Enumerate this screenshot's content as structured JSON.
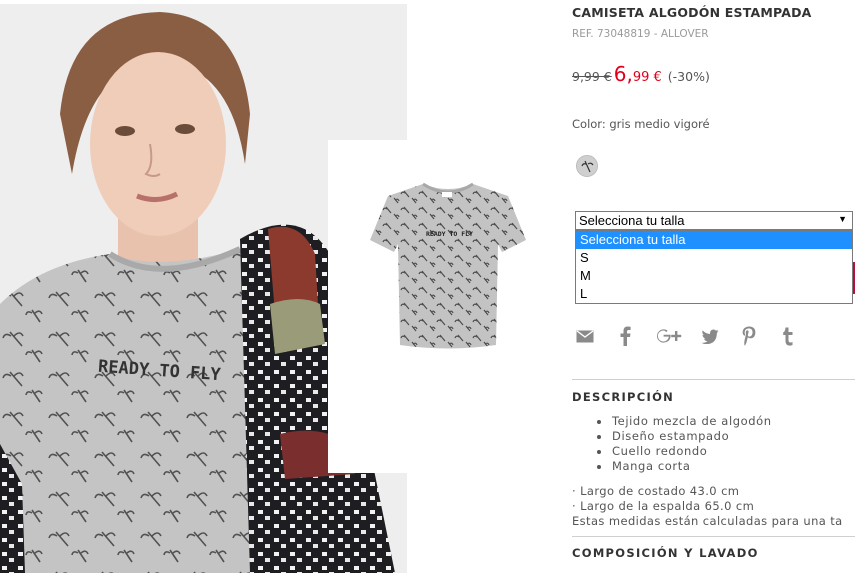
{
  "product": {
    "title": "CAMISETA ALGODÓN ESTAMPADA",
    "ref": "REF. 73048819 - ALLOVER",
    "old_price": "9,99 €",
    "new_price_int": "6,",
    "new_price_dec": "99 €",
    "discount": "(-30%)",
    "color_label": "Color: gris medio vigoré"
  },
  "size_select": {
    "selected": "Selecciona tu talla",
    "options": [
      "Selecciona tu talla",
      "S",
      "M",
      "L"
    ]
  },
  "share": {
    "items": [
      {
        "name": "email-icon",
        "glyph": "✉"
      },
      {
        "name": "facebook-icon",
        "glyph": "f"
      },
      {
        "name": "google-plus-icon",
        "glyph": "G+"
      },
      {
        "name": "twitter-icon",
        "glyph": "bird"
      },
      {
        "name": "pinterest-icon",
        "glyph": "P"
      },
      {
        "name": "tumblr-icon",
        "glyph": "t"
      }
    ]
  },
  "description": {
    "title": "DESCRIPCIÓN",
    "bullets": [
      "Tejido mezcla de algodón",
      "Diseño estampado",
      "Cuello redondo",
      "Manga corta"
    ],
    "measures": [
      "· Largo de costado 43.0 cm",
      "· Largo de la espalda 65.0 cm",
      "Estas medidas están calculadas para una ta"
    ]
  },
  "composition": {
    "title": "COMPOSICIÓN Y LAVADO"
  },
  "images": {
    "model_print_text": "READY TO FLY",
    "flat_print_text": "READY TO FLY"
  },
  "colors": {
    "sale_red": "#e0001b",
    "select_highlight": "#1e90ff",
    "buy_button": "#b30f3a",
    "icon_gray": "#8a8a8a"
  }
}
